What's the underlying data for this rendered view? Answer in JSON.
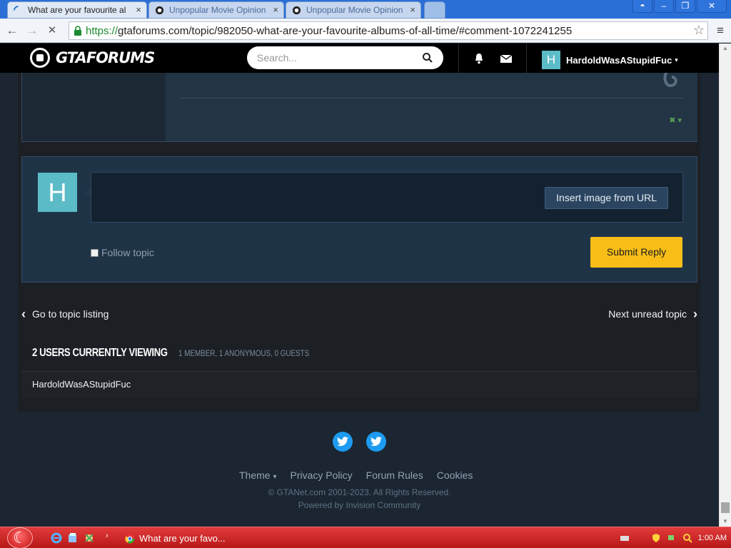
{
  "browser": {
    "tabs": [
      {
        "title": "What are your favourite al",
        "active": true
      },
      {
        "title": "Unpopular Movie Opinion",
        "active": false
      },
      {
        "title": "Unpopular Movie Opinion",
        "active": false
      }
    ],
    "tab_close": "×",
    "url_scheme": "https://",
    "url_rest": "gtaforums.com/topic/982050-what-are-your-favourite-albums-of-all-time/#comment-1072241255",
    "back_glyph": "←",
    "forward_glyph": "→",
    "reload_glyph": "✕",
    "star_glyph": "☆",
    "menu_glyph": "≡"
  },
  "header": {
    "logo_text": "GTAFORUMS",
    "search_placeholder": "Search...",
    "user_initial": "H",
    "username": "HardoldWasAStupidFuc",
    "caret": "▾"
  },
  "reply": {
    "avatar_initial": "H",
    "insert_image_label": "Insert image from URL",
    "follow_label": "Follow topic",
    "submit_label": "Submit Reply"
  },
  "topic_nav": {
    "prev_label": "Go to topic listing",
    "next_label": "Next unread topic",
    "prev_glyph": "‹",
    "next_glyph": "›"
  },
  "viewing": {
    "heading": "2 USERS CURRENTLY VIEWING",
    "sub": "1 MEMBER, 1 ANONYMOUS, 0 GUESTS",
    "users": [
      "HardoldWasAStupidFuc"
    ]
  },
  "footer": {
    "theme_label": "Theme",
    "theme_caret": "▾",
    "links": [
      "Privacy Policy",
      "Forum Rules",
      "Cookies"
    ],
    "copyright": "© GTANet.com 2001-2023. All Rights Reserved.",
    "powered": "Powered by Invision Community"
  },
  "taskbar": {
    "task_label": "What are your favo...",
    "clock": "1:00 AM",
    "arrow": "›"
  },
  "colors": {
    "accent_submit": "#f8be17",
    "avatar": "#5bbcc7",
    "twitter": "#1d9bf0",
    "taskbar": "#c41e1e"
  },
  "icons": [
    "loading-spinner-icon",
    "site-favicon-icon",
    "lock-icon",
    "star-icon",
    "menu-icon",
    "gtaforums-logo-icon",
    "search-icon",
    "bell-icon",
    "envelope-icon",
    "twitter-icon",
    "start-orb-icon",
    "ie-icon",
    "chrome-icon",
    "shield-icon",
    "speaker-icon"
  ]
}
